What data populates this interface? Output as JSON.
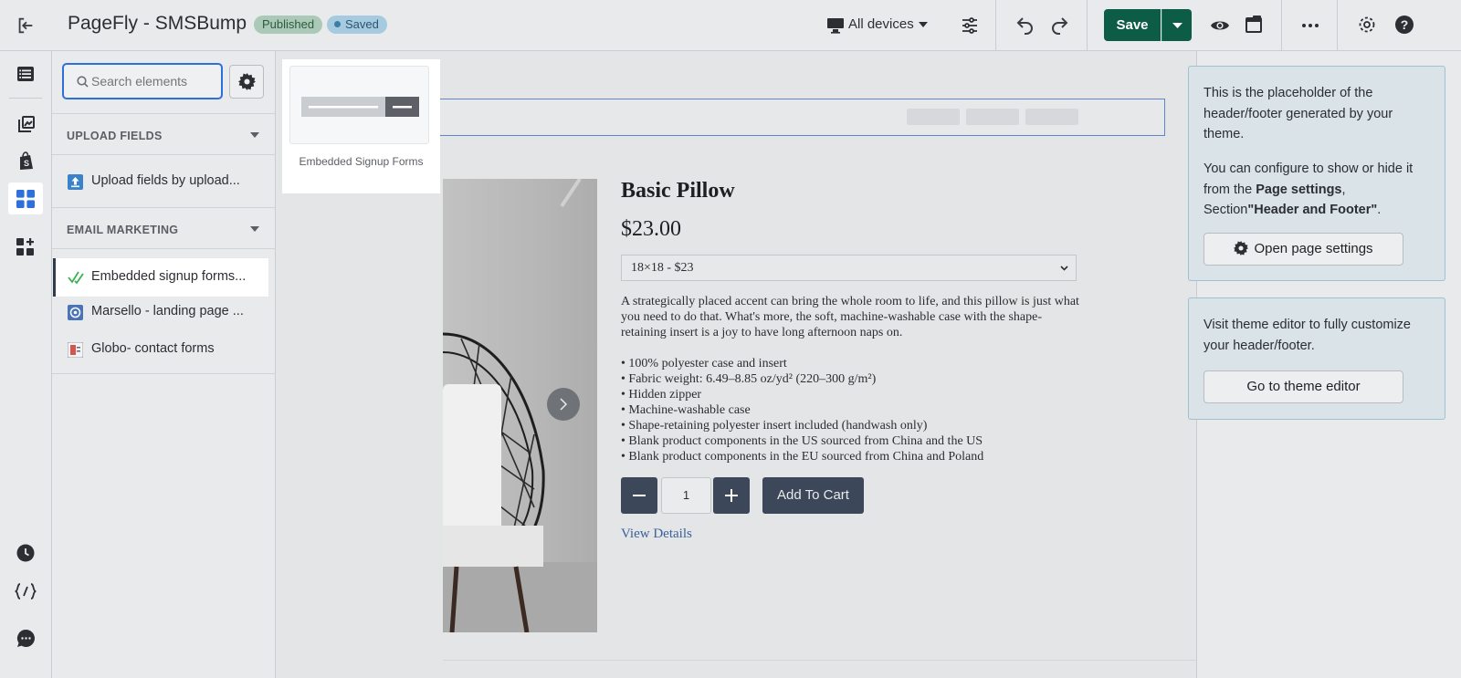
{
  "topbar": {
    "title": "PageFly - SMSBump",
    "published_badge": "Published",
    "saved_badge": "Saved",
    "device_label": "All devices",
    "save_label": "Save"
  },
  "search": {
    "placeholder": "Search elements"
  },
  "sections": [
    {
      "title": "UPLOAD FIELDS",
      "items": [
        {
          "label": "Upload fields by upload...",
          "icon": "upload-app-icon"
        }
      ]
    },
    {
      "title": "EMAIL MARKETING",
      "items": [
        {
          "label": "Embedded signup forms...",
          "icon": "smsbump-app-icon"
        },
        {
          "label": "Marsello - landing page ...",
          "icon": "marsello-app-icon"
        },
        {
          "label": "Globo- contact forms",
          "icon": "globo-app-icon"
        }
      ]
    }
  ],
  "preview_card": {
    "label": "Embedded Signup Forms"
  },
  "product": {
    "title": "Basic Pillow",
    "price": "$23.00",
    "variant": "18×18 - $23",
    "description": "A strategically placed accent can bring the whole room to life, and this pillow is just what you need to do that. What's more, the soft, machine-washable case with the shape-retaining insert is a joy to have long afternoon naps on.",
    "bullets": [
      "• 100% polyester case and insert",
      "• Fabric weight: 6.49–8.85 oz/yd² (220–300 g/m²)",
      "• Hidden zipper",
      "• Machine-washable case",
      "• Shape-retaining polyester insert included (handwash only)",
      "• Blank product components in the US sourced from China and the US",
      "• Blank product components in the EU sourced from China and Poland"
    ],
    "quantity": "1",
    "add_to_cart": "Add To Cart",
    "view_details": "View Details"
  },
  "right_panel": {
    "placeholder_text_1": "This is the placeholder of the header/footer generated by your theme.",
    "configure_pre": "You can configure to show or hide it from the ",
    "configure_bold1": "Page settings",
    "configure_mid": ", Section",
    "configure_bold2": "\"Header and Footer\"",
    "configure_post": ".",
    "open_settings_label": "Open page settings",
    "theme_editor_text": "Visit theme editor to fully customize your header/footer.",
    "theme_editor_button": "Go to theme editor"
  },
  "colors": {
    "save_button": "#0d5c45",
    "accent_blue": "#2f6fdb",
    "product_button": "#3c4759"
  }
}
